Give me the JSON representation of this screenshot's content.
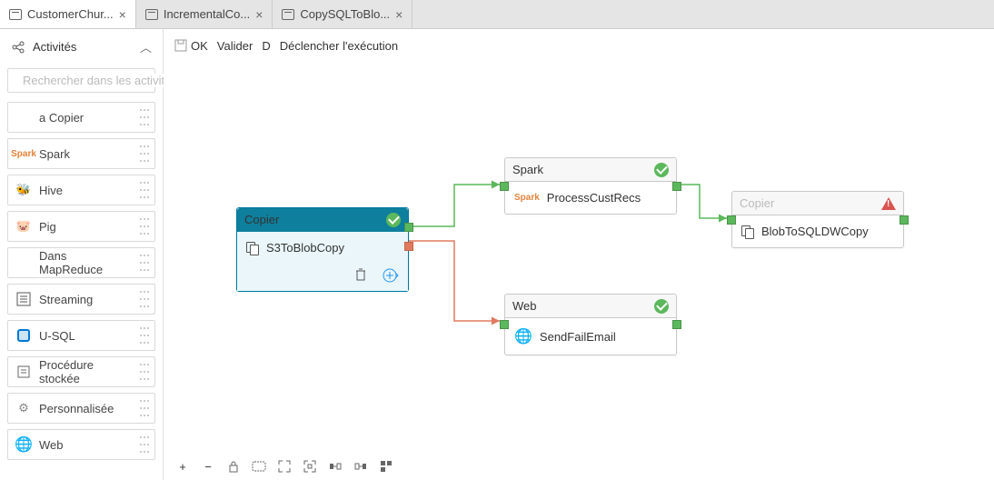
{
  "tabs": [
    {
      "label": "CustomerChur...",
      "active": true
    },
    {
      "label": "IncrementalCo...",
      "active": false
    },
    {
      "label": "CopySQLToBlo...",
      "active": false
    }
  ],
  "sidebar": {
    "title": "Activités",
    "search_placeholder": "Rechercher dans les activités",
    "items": [
      {
        "name": "copy",
        "label": "a Copier",
        "icon": ""
      },
      {
        "name": "spark",
        "label": "Spark",
        "icon": "spark"
      },
      {
        "name": "hive",
        "label": "Hive",
        "icon": "hive"
      },
      {
        "name": "pig",
        "label": "Pig",
        "icon": "pig"
      },
      {
        "name": "mapreduce",
        "label": "Dans MapReduce",
        "icon": ""
      },
      {
        "name": "streaming",
        "label": "Streaming",
        "icon": "stream"
      },
      {
        "name": "usql",
        "label": "U-SQL",
        "icon": "usql"
      },
      {
        "name": "proc",
        "label": "Procédure stockée",
        "icon": "proc"
      },
      {
        "name": "custom",
        "label": "Personnalisée",
        "icon": "gear"
      },
      {
        "name": "web",
        "label": "Web",
        "icon": "web"
      }
    ]
  },
  "toolbar": {
    "save": "OK",
    "validate": "Valider",
    "debug": "D",
    "trigger": "Déclencher l'exécution"
  },
  "nodes": {
    "s3": {
      "type": "Copier",
      "label": "S3ToBlobCopy",
      "status": "ok",
      "selected": true
    },
    "spark": {
      "type": "Spark",
      "label": "ProcessCustRecs",
      "status": "ok",
      "selected": false
    },
    "web": {
      "type": "Web",
      "label": "SendFailEmail",
      "status": "ok",
      "selected": false
    },
    "dw": {
      "type": "Copier",
      "label": "BlobToSQLDWCopy",
      "status": "err",
      "selected": false
    }
  },
  "bottom_tools": [
    "+",
    "−",
    "lock",
    "code",
    "fit",
    "expand",
    "nav1",
    "nav2",
    "align"
  ]
}
